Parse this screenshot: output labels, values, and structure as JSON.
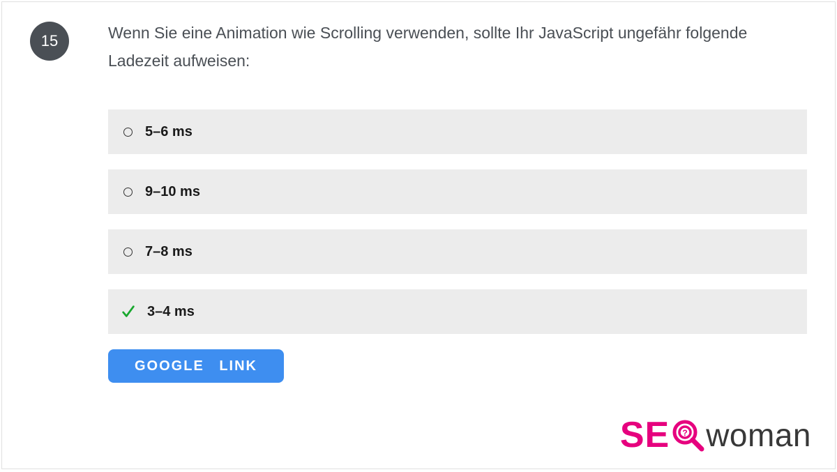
{
  "question": {
    "number": "15",
    "text": "Wenn Sie eine Animation wie Scrolling verwenden, sollte Ihr JavaScript ungefähr folgende Ladezeit aufweisen:"
  },
  "options": [
    {
      "label": "5–6 ms",
      "correct": false
    },
    {
      "label": "9–10 ms",
      "correct": false
    },
    {
      "label": "7–8 ms",
      "correct": false
    },
    {
      "label": "3–4 ms",
      "correct": true
    }
  ],
  "button": {
    "label": "GOOGLE LINK"
  },
  "brand": {
    "se": "SE",
    "woman": "woman"
  },
  "colors": {
    "accent_pink": "#e6007e",
    "button_blue": "#3e8ef0",
    "check_green": "#18a82e",
    "badge_grey": "#4a4f55",
    "option_bg": "#ececec"
  }
}
